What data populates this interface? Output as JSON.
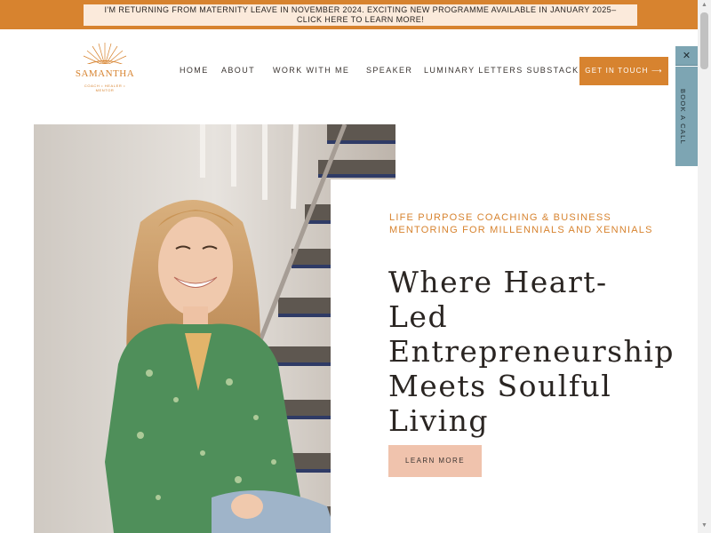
{
  "announcement": {
    "line1": "I'M RETURNING FROM MATERNITY LEAVE IN NOVEMBER 2024. EXCITING NEW PROGRAMME AVAILABLE IN JANUARY 2025–",
    "line2": "CLICK HERE TO LEARN MORE!"
  },
  "logo": {
    "name": "SAMANTHA",
    "tagline": "COACH • HEALER • MENTOR"
  },
  "nav": {
    "items": [
      {
        "label": "HOME"
      },
      {
        "label": "ABOUT"
      },
      {
        "label": "WORK WITH ME"
      },
      {
        "label": "SPEAKER"
      },
      {
        "label": "LUMINARY LETTERS SUBSTACK"
      }
    ],
    "cta_label": "GET IN TOUCH ⟶"
  },
  "side_tab": {
    "close_label": "✕",
    "label": "BOOK A CALL"
  },
  "hero": {
    "eyebrow_line1": "LIFE PURPOSE COACHING & BUSINESS",
    "eyebrow_line2": "MENTORING FOR MILLENNIALS AND XENNIALS",
    "headline_lines": [
      "Where Heart-",
      "Led",
      "Entrepreneurship",
      "Meets Soulful",
      "Living"
    ],
    "button_label": "LEARN MORE"
  },
  "colors": {
    "accent": "#d7832f",
    "announcement_box": "#fbeadb",
    "side_tab": "#7da5b3",
    "learn_button": "#f0c3ad"
  },
  "icons": {
    "logo_mark": "sunrise-icon",
    "close": "close-icon",
    "scroll_up": "chevron-up-icon",
    "scroll_down": "chevron-down-icon"
  }
}
